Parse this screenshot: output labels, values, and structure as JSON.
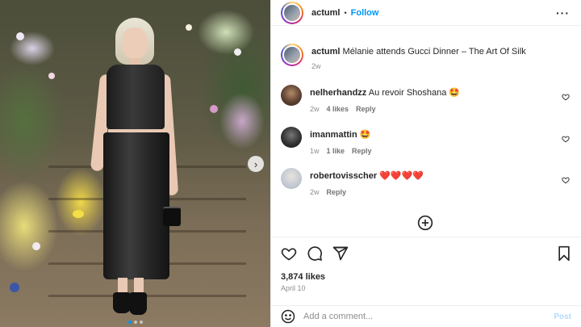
{
  "post": {
    "username": "actuml",
    "separator": "•",
    "follow_label": "Follow",
    "more_icon": "more-horizontal-icon",
    "caption": {
      "username": "actuml",
      "text": "Mélanie attends Gucci Dinner – The Art Of Silk",
      "age": "2w"
    },
    "carousel": {
      "next_icon": "chevron-right-icon",
      "slides": 3,
      "active": 1
    }
  },
  "comments": [
    {
      "username": "nelherhandzz",
      "text": "Au revoir Shoshana 🤩",
      "age": "2w",
      "likes": "4 likes",
      "reply": "Reply"
    },
    {
      "username": "imanmattin",
      "text": "🤩",
      "age": "1w",
      "likes": "1 like",
      "reply": "Reply"
    },
    {
      "username": "robertovisscher",
      "text": "❤️❤️❤️❤️",
      "age": "2w",
      "likes": "",
      "reply": "Reply"
    }
  ],
  "load_more_icon": "plus-circle-icon",
  "actions": {
    "like_icon": "heart-icon",
    "comment_icon": "comment-icon",
    "share_icon": "send-icon",
    "save_icon": "bookmark-icon"
  },
  "likes_count": "3,874 likes",
  "post_date": "April 10",
  "composer": {
    "emoji_icon": "smiley-icon",
    "placeholder": "Add a comment...",
    "post_label": "Post"
  },
  "colors": {
    "accent": "#0095f6",
    "post_disabled": "#b3dbff",
    "muted": "#8e8e8e",
    "text": "#262626"
  }
}
